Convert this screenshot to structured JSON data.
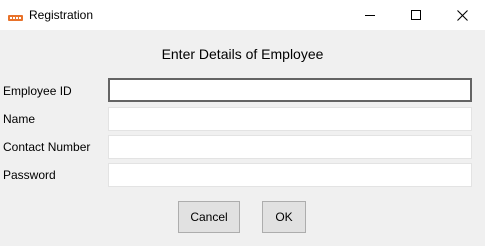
{
  "window": {
    "title": "Registration",
    "icon": "app-logo-icon",
    "controls": {
      "minimize": "minimize-icon",
      "maximize": "maximize-icon",
      "close": "close-icon"
    }
  },
  "form": {
    "heading": "Enter Details of Employee",
    "fields": [
      {
        "label": "Employee ID",
        "value": ""
      },
      {
        "label": "Name",
        "value": ""
      },
      {
        "label": "Contact Number",
        "value": ""
      },
      {
        "label": "Password",
        "value": ""
      }
    ]
  },
  "buttons": {
    "cancel": "Cancel",
    "ok": "OK"
  },
  "colors": {
    "window_bg": "#f0f0f0",
    "titlebar_bg": "#ffffff",
    "button_bg": "#e1e1e1",
    "focus_border": "#646464",
    "logo_orange": "#e8722a"
  }
}
